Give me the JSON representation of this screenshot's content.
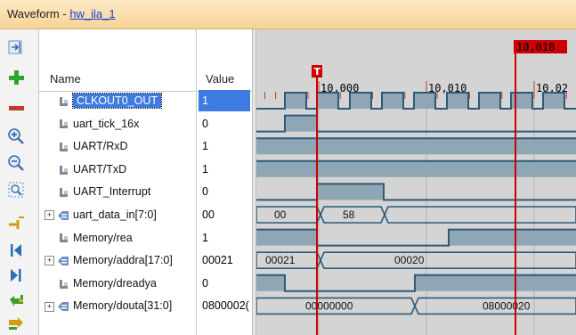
{
  "window": {
    "title_prefix": "Waveform - ",
    "title_link": "hw_ila_1"
  },
  "columns": {
    "name": "Name",
    "value": "Value"
  },
  "markers": {
    "cursor_label": "T",
    "marker_label": "10,018"
  },
  "ruler": {
    "ticks": [
      "10,000",
      "10,010",
      "10,02"
    ]
  },
  "toolbar": {
    "icons": [
      "zoom-fit-icon",
      "add-icon",
      "remove-icon",
      "zoom-in-icon",
      "zoom-out-icon",
      "zoom-area-icon",
      "goto-cursor-icon",
      "goto-start-icon",
      "goto-end-icon",
      "prev-transition-icon",
      "next-transition-icon"
    ]
  },
  "colors": {
    "wave_bg": "#d4d4d4",
    "signal": "#2e5a7a",
    "fill": "#8fa6b4",
    "cursor": "#cc0000",
    "selection": "#3d7be0"
  },
  "signals": [
    {
      "name": "CLKOUT0_OUT",
      "value": "1",
      "bus": false,
      "selected": true
    },
    {
      "name": "uart_tick_16x",
      "value": "0",
      "bus": false
    },
    {
      "name": "UART/RxD",
      "value": "1",
      "bus": false
    },
    {
      "name": "UART/TxD",
      "value": "1",
      "bus": false
    },
    {
      "name": "UART_Interrupt",
      "value": "0",
      "bus": false
    },
    {
      "name": "uart_data_in[7:0]",
      "value": "00",
      "bus": true
    },
    {
      "name": "Memory/rea",
      "value": "1",
      "bus": false
    },
    {
      "name": "Memory/addra[17:0]",
      "value": "00021",
      "bus": true
    },
    {
      "name": "Memory/dreadya",
      "value": "0",
      "bus": false
    },
    {
      "name": "Memory/douta[31:0]",
      "value": "0800002(",
      "bus": true
    }
  ],
  "bus_labels": {
    "uart_data_in": [
      "00",
      "58"
    ],
    "addra": [
      "00021",
      "00020"
    ],
    "douta": [
      "00000000",
      "08000020"
    ]
  }
}
